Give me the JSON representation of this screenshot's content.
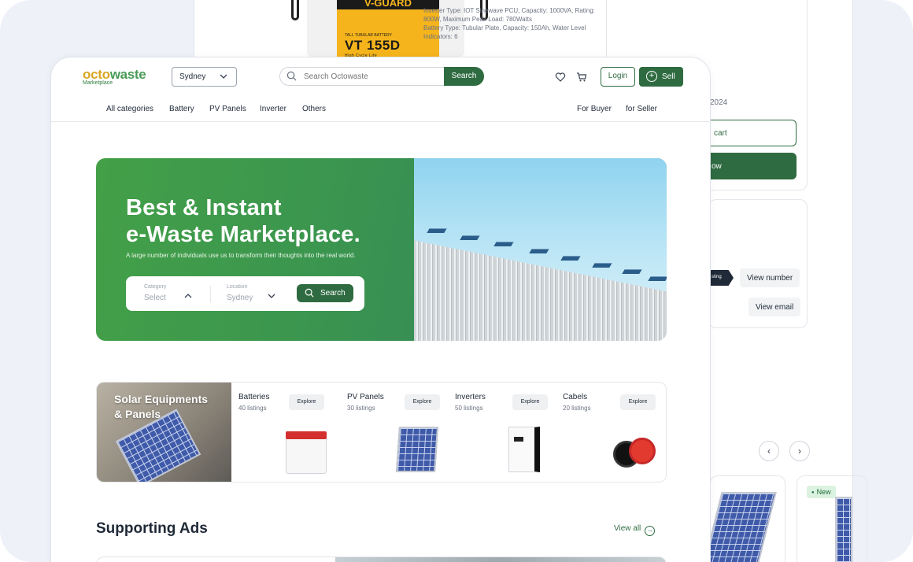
{
  "back_page": {
    "product_brand": "V-GUARD",
    "product_tag": "TALL TUBULAR BATTERY",
    "product_model": "VT 155D",
    "product_model_sub": "High Cycle Life",
    "specs_1": "Inverter Type: IOT Sinewave PCU, Capacity: 1000VA, Rating: 800W, Maximum Peak Load: 780Watts",
    "specs_2": "Battery Type: Tubular Plate, Capacity: 150Ah, Water Level Indicators: 6",
    "date_partial": "2024",
    "add_to_cart_partial": "cart",
    "buy_now_partial": "ow",
    "listing_tag": "sting",
    "view_number": "View number",
    "view_email": "View email",
    "prev_icon": "‹",
    "next_icon": "›",
    "new_badge": "New"
  },
  "header": {
    "logo_octo": "octo",
    "logo_waste": "waste",
    "logo_sub": "Marketplace",
    "location_value": "Sydney",
    "search_placeholder": "Search Octowaste",
    "search_button": "Search",
    "login_label": "Login",
    "sell_label": "Sell"
  },
  "nav": {
    "left": [
      "All categories",
      "Battery",
      "PV Panels",
      "Inverter",
      "Others"
    ],
    "right": [
      "For Buyer",
      "for Seller"
    ]
  },
  "hero": {
    "title_line1": "Best & Instant",
    "title_line2": "e-Waste Marketplace.",
    "subtitle": "A large number of individuals use us to transform their thoughts into the real world.",
    "category_label": "Category",
    "category_value": "Select",
    "location_label": "Location",
    "location_value": "Sydney",
    "search_button": "Search"
  },
  "categories": {
    "hero_title_line1": "Solar Equipments",
    "hero_title_line2": "& Panels",
    "items": [
      {
        "name": "Batteries",
        "count": "40 listings",
        "button": "Explore"
      },
      {
        "name": "PV Panels",
        "count": "30 listings",
        "button": "Explore"
      },
      {
        "name": "Inverters",
        "count": "50 listings",
        "button": "Explore"
      },
      {
        "name": "Cabels",
        "count": "20 listings",
        "button": "Explore"
      }
    ]
  },
  "ads": {
    "title": "Supporting Ads",
    "view_all": "View all"
  },
  "colors": {
    "brand_green": "#2f6b40",
    "hero_green": "#43a047",
    "logo_yellow": "#d9a623"
  }
}
